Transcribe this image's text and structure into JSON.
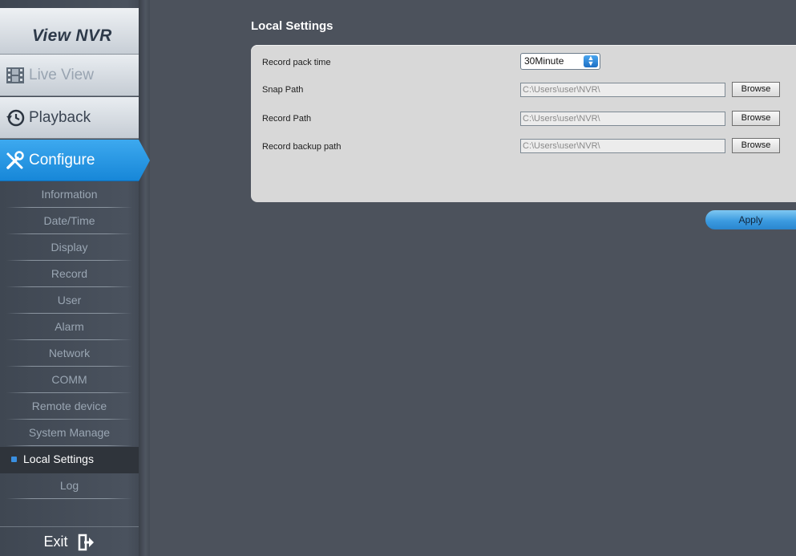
{
  "app": {
    "title": "View NVR"
  },
  "main_nav": [
    {
      "label": "Live View",
      "icon": "film-icon"
    },
    {
      "label": "Playback",
      "icon": "history-clock-icon"
    },
    {
      "label": "Configure",
      "icon": "tools-icon",
      "active": true
    }
  ],
  "sub_nav": [
    {
      "label": "Information"
    },
    {
      "label": "Date/Time"
    },
    {
      "label": "Display"
    },
    {
      "label": "Record"
    },
    {
      "label": "User"
    },
    {
      "label": "Alarm"
    },
    {
      "label": "Network"
    },
    {
      "label": "COMM"
    },
    {
      "label": "Remote device"
    },
    {
      "label": "System Manage"
    },
    {
      "label": "Local Settings",
      "active": true
    },
    {
      "label": "Log"
    }
  ],
  "exit": {
    "label": "Exit",
    "icon": "exit-arrow-icon"
  },
  "page": {
    "title": "Local Settings",
    "record_pack_time": {
      "label": "Record pack time",
      "value": "30Minute"
    },
    "snap_path": {
      "label": "Snap Path",
      "value": "C:\\Users\\user\\NVR\\",
      "button": "Browse"
    },
    "record_path": {
      "label": "Record Path",
      "value": "C:\\Users\\user\\NVR\\",
      "button": "Browse"
    },
    "record_backup_path": {
      "label": "Record backup path",
      "value": "C:\\Users\\user\\NVR\\",
      "button": "Browse"
    },
    "apply_label": "Apply"
  },
  "colors": {
    "accent": "#1787d8",
    "background": "#4c525c",
    "panel": "#d8d8d8"
  }
}
